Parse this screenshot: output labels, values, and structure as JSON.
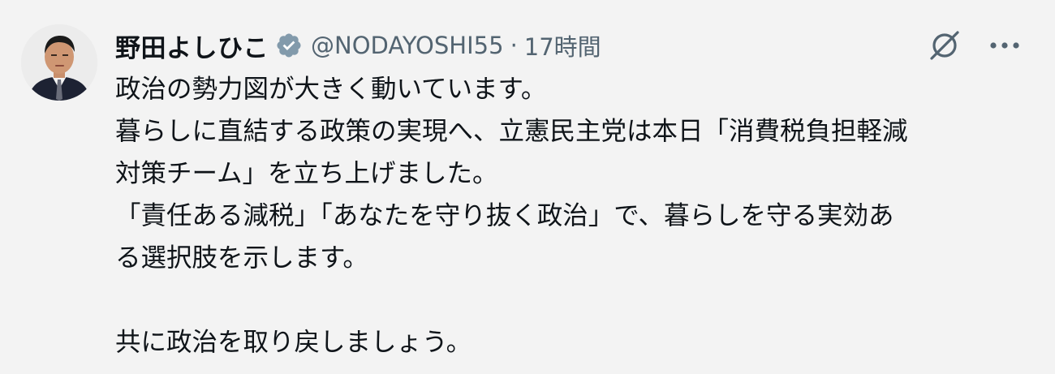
{
  "user": {
    "display_name": "野田よしひこ",
    "handle": "@NODAYOSHI55",
    "separator": "·",
    "time": "17時間"
  },
  "icons": {
    "verified": "verified-badge-icon",
    "grok": "grok-icon",
    "more": "more-dots-icon"
  },
  "colors": {
    "verified_badge": "#829aab",
    "text": "#0f1419",
    "muted": "#536471",
    "background": "#f3f3f3"
  },
  "body": {
    "lines": [
      "政治の勢力図が大きく動いています。",
      "暮らしに直結する政策の実現へ、立憲民主党は本日「消費税負担軽減",
      "対策チーム」を立ち上げました。",
      "「責任ある減税」「あなたを守り抜く政治」で、暮らしを守る実効あ",
      "る選択肢を示します。",
      "",
      "共に政治を取り戻しましょう。"
    ]
  }
}
